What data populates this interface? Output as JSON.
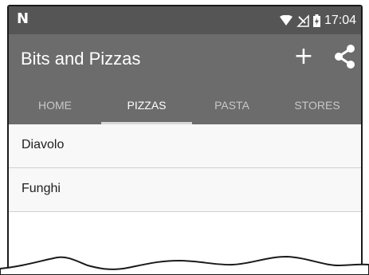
{
  "status_bar": {
    "time": "17:04",
    "icons": [
      "notification-icon",
      "wifi-icon",
      "no-signal-icon",
      "battery-icon"
    ]
  },
  "app_bar": {
    "title": "Bits and Pizzas",
    "actions": [
      "add-icon",
      "share-icon"
    ]
  },
  "tabs": [
    {
      "label": "HOME",
      "selected": false
    },
    {
      "label": "PIZZAS",
      "selected": true
    },
    {
      "label": "PASTA",
      "selected": false
    },
    {
      "label": "STORES",
      "selected": false
    }
  ],
  "list": {
    "items": [
      {
        "label": "Diavolo"
      },
      {
        "label": "Funghi"
      }
    ]
  },
  "colors": {
    "status_bar": "#555555",
    "app_bar": "#6c6c6c",
    "tab_indicator": "#d8d8d8",
    "list_background": "#f8f8f8"
  }
}
